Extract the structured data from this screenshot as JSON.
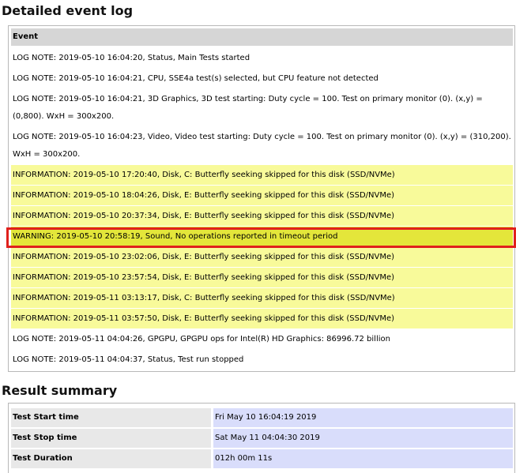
{
  "event_log": {
    "title": "Detailed event log",
    "column_header": "Event",
    "rows": [
      {
        "kind": "log_note",
        "text": "LOG NOTE: 2019-05-10 16:04:20, Status, Main Tests started"
      },
      {
        "kind": "log_note",
        "text": "LOG NOTE: 2019-05-10 16:04:21, CPU, SSE4a test(s) selected, but CPU feature not detected"
      },
      {
        "kind": "log_note",
        "text": "LOG NOTE: 2019-05-10 16:04:21, 3D Graphics, 3D test starting: Duty cycle = 100. Test on primary monitor (0). (x,y) = (0,800). WxH = 300x200."
      },
      {
        "kind": "log_note",
        "text": "LOG NOTE: 2019-05-10 16:04:23, Video, Video test starting: Duty cycle = 100. Test on primary monitor (0). (x,y) = (310,200). WxH = 300x200."
      },
      {
        "kind": "information",
        "text": "INFORMATION: 2019-05-10 17:20:40, Disk, C: Butterfly seeking skipped for this disk (SSD/NVMe)"
      },
      {
        "kind": "information",
        "text": "INFORMATION: 2019-05-10 18:04:26, Disk, E: Butterfly seeking skipped for this disk (SSD/NVMe)"
      },
      {
        "kind": "information",
        "text": "INFORMATION: 2019-05-10 20:37:34, Disk, E: Butterfly seeking skipped for this disk (SSD/NVMe)"
      },
      {
        "kind": "warning",
        "text": "WARNING: 2019-05-10 20:58:19, Sound, No operations reported in timeout period"
      },
      {
        "kind": "information",
        "text": "INFORMATION: 2019-05-10 23:02:06, Disk, E: Butterfly seeking skipped for this disk (SSD/NVMe)"
      },
      {
        "kind": "information",
        "text": "INFORMATION: 2019-05-10 23:57:54, Disk, E: Butterfly seeking skipped for this disk (SSD/NVMe)"
      },
      {
        "kind": "information",
        "text": "INFORMATION: 2019-05-11 03:13:17, Disk, C: Butterfly seeking skipped for this disk (SSD/NVMe)"
      },
      {
        "kind": "information",
        "text": "INFORMATION: 2019-05-11 03:57:50, Disk, E: Butterfly seeking skipped for this disk (SSD/NVMe)"
      },
      {
        "kind": "log_note",
        "text": "LOG NOTE: 2019-05-11 04:04:26, GPGPU, GPGPU ops for Intel(R) HD Graphics: 86996.72 billion"
      },
      {
        "kind": "log_note",
        "text": "LOG NOTE: 2019-05-11 04:04:37, Status, Test run stopped"
      }
    ]
  },
  "result_summary": {
    "title": "Result summary",
    "rows": [
      {
        "label": "Test Start time",
        "value": "Fri May 10 16:04:19 2019"
      },
      {
        "label": "Test Stop time",
        "value": "Sat May 11 04:04:30 2019"
      },
      {
        "label": "Test Duration",
        "value": "012h 00m 11s"
      }
    ]
  },
  "colors": {
    "information_row": "#f8fa9a",
    "warning_row": "#e4e63a",
    "highlight_border": "#e0201c",
    "summary_value_bg": "#d9ddfb"
  }
}
